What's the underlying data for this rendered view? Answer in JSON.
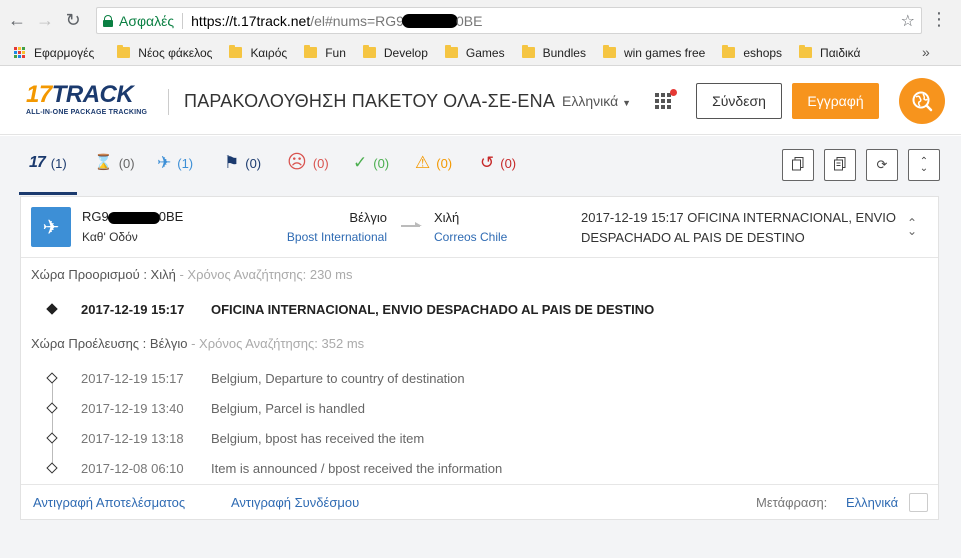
{
  "browser": {
    "secure_label": "Ασφαλές",
    "url_host": "https://t.17track.net",
    "url_path_prefix": "/el#nums=RG9",
    "url_path_suffix": "0BE",
    "bookmarks": [
      {
        "label": "Εφαρμογές",
        "icon": "apps-icon"
      },
      {
        "label": "Νέος φάκελος",
        "icon": "folder-icon"
      },
      {
        "label": "Καιρός",
        "icon": "folder-icon"
      },
      {
        "label": "Fun",
        "icon": "folder-icon"
      },
      {
        "label": "Develop",
        "icon": "folder-icon"
      },
      {
        "label": "Games",
        "icon": "folder-icon"
      },
      {
        "label": "Bundles",
        "icon": "folder-icon"
      },
      {
        "label": "win games free",
        "icon": "folder-icon"
      },
      {
        "label": "eshops",
        "icon": "folder-icon"
      },
      {
        "label": "Παιδικά",
        "icon": "folder-icon"
      }
    ],
    "more_label": "»"
  },
  "header": {
    "logo_num": "17",
    "logo_text": "TRACK",
    "logo_tagline": "ALL-IN-ONE PACKAGE TRACKING",
    "title": "ΠΑΡΑΚΟΛΟΥΘΗΣΗ ΠΑΚΕΤΟΥ ΟΛΑ-ΣΕ-ΕΝΑ",
    "language": "Ελληνικά",
    "login": "Σύνδεση",
    "register": "Εγγραφή"
  },
  "filters": [
    {
      "icon": "17-logo-icon",
      "glyph": "17",
      "count": "(1)",
      "color": "#1b3a6e"
    },
    {
      "icon": "hourglass-icon",
      "glyph": "⌛",
      "count": "(0)",
      "color": "#666666"
    },
    {
      "icon": "airplane-icon",
      "glyph": "✈",
      "count": "(1)",
      "color": "#3d8fd6"
    },
    {
      "icon": "flag-icon",
      "glyph": "⚑",
      "count": "(0)",
      "color": "#1b3a6e"
    },
    {
      "icon": "sad-face-icon",
      "glyph": "☹",
      "count": "(0)",
      "color": "#d9534f"
    },
    {
      "icon": "checkmark-icon",
      "glyph": "✓",
      "count": "(0)",
      "color": "#4caf50"
    },
    {
      "icon": "warning-icon",
      "glyph": "⚠",
      "count": "(0)",
      "color": "#f39800"
    },
    {
      "icon": "history-icon",
      "glyph": "↺",
      "count": "(0)",
      "color": "#c62828"
    }
  ],
  "shipment": {
    "number_prefix": "RG9",
    "number_suffix": "0BE",
    "status": "Καθ' Οδόν",
    "origin_country": "Βέλγιο",
    "origin_carrier": "Bpost International",
    "dest_country": "Χιλή",
    "dest_carrier": "Correos Chile",
    "latest_event": "2017-12-19 15:17  OFICINA INTERNACIONAL, ENVIO DESPACHADO AL PAIS DE DESTINO"
  },
  "destination_section": {
    "label": "Χώρα Προορισμού : Χιλή",
    "query_time": " - Χρόνος Αναζήτησης: 230 ms",
    "events": [
      {
        "date": "2017-12-19 15:17",
        "desc": "OFICINA INTERNACIONAL, ENVIO DESPACHADO AL PAIS DE DESTINO"
      }
    ]
  },
  "origin_section": {
    "label": "Χώρα Προέλευσης : Βέλγιο",
    "query_time": " - Χρόνος Αναζήτησης: 352 ms",
    "events": [
      {
        "date": "2017-12-19 15:17",
        "desc": "Belgium, Departure to country of destination"
      },
      {
        "date": "2017-12-19 13:40",
        "desc": "Belgium, Parcel is handled"
      },
      {
        "date": "2017-12-19 13:18",
        "desc": "Belgium, bpost has received the item"
      },
      {
        "date": "2017-12-08 06:10",
        "desc": "Item is announced / bpost received the information"
      }
    ]
  },
  "footer": {
    "copy_result": "Αντιγραφή Αποτελέσματος",
    "copy_link": "Αντιγραφή Συνδέσμου",
    "translate_label": "Μετάφραση:",
    "translate_lang": "Ελληνικά"
  }
}
